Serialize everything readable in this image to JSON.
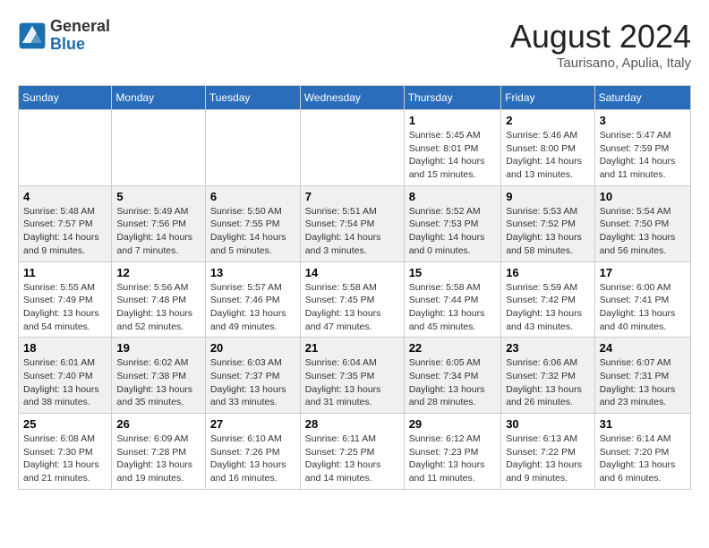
{
  "header": {
    "logo": {
      "general": "General",
      "blue": "Blue"
    },
    "title": "August 2024",
    "location": "Taurisano, Apulia, Italy"
  },
  "days_of_week": [
    "Sunday",
    "Monday",
    "Tuesday",
    "Wednesday",
    "Thursday",
    "Friday",
    "Saturday"
  ],
  "weeks": [
    [
      {
        "day": "",
        "info": ""
      },
      {
        "day": "",
        "info": ""
      },
      {
        "day": "",
        "info": ""
      },
      {
        "day": "",
        "info": ""
      },
      {
        "day": "1",
        "info": "Sunrise: 5:45 AM\nSunset: 8:01 PM\nDaylight: 14 hours and 15 minutes."
      },
      {
        "day": "2",
        "info": "Sunrise: 5:46 AM\nSunset: 8:00 PM\nDaylight: 14 hours and 13 minutes."
      },
      {
        "day": "3",
        "info": "Sunrise: 5:47 AM\nSunset: 7:59 PM\nDaylight: 14 hours and 11 minutes."
      }
    ],
    [
      {
        "day": "4",
        "info": "Sunrise: 5:48 AM\nSunset: 7:57 PM\nDaylight: 14 hours and 9 minutes."
      },
      {
        "day": "5",
        "info": "Sunrise: 5:49 AM\nSunset: 7:56 PM\nDaylight: 14 hours and 7 minutes."
      },
      {
        "day": "6",
        "info": "Sunrise: 5:50 AM\nSunset: 7:55 PM\nDaylight: 14 hours and 5 minutes."
      },
      {
        "day": "7",
        "info": "Sunrise: 5:51 AM\nSunset: 7:54 PM\nDaylight: 14 hours and 3 minutes."
      },
      {
        "day": "8",
        "info": "Sunrise: 5:52 AM\nSunset: 7:53 PM\nDaylight: 14 hours and 0 minutes."
      },
      {
        "day": "9",
        "info": "Sunrise: 5:53 AM\nSunset: 7:52 PM\nDaylight: 13 hours and 58 minutes."
      },
      {
        "day": "10",
        "info": "Sunrise: 5:54 AM\nSunset: 7:50 PM\nDaylight: 13 hours and 56 minutes."
      }
    ],
    [
      {
        "day": "11",
        "info": "Sunrise: 5:55 AM\nSunset: 7:49 PM\nDaylight: 13 hours and 54 minutes."
      },
      {
        "day": "12",
        "info": "Sunrise: 5:56 AM\nSunset: 7:48 PM\nDaylight: 13 hours and 52 minutes."
      },
      {
        "day": "13",
        "info": "Sunrise: 5:57 AM\nSunset: 7:46 PM\nDaylight: 13 hours and 49 minutes."
      },
      {
        "day": "14",
        "info": "Sunrise: 5:58 AM\nSunset: 7:45 PM\nDaylight: 13 hours and 47 minutes."
      },
      {
        "day": "15",
        "info": "Sunrise: 5:58 AM\nSunset: 7:44 PM\nDaylight: 13 hours and 45 minutes."
      },
      {
        "day": "16",
        "info": "Sunrise: 5:59 AM\nSunset: 7:42 PM\nDaylight: 13 hours and 43 minutes."
      },
      {
        "day": "17",
        "info": "Sunrise: 6:00 AM\nSunset: 7:41 PM\nDaylight: 13 hours and 40 minutes."
      }
    ],
    [
      {
        "day": "18",
        "info": "Sunrise: 6:01 AM\nSunset: 7:40 PM\nDaylight: 13 hours and 38 minutes."
      },
      {
        "day": "19",
        "info": "Sunrise: 6:02 AM\nSunset: 7:38 PM\nDaylight: 13 hours and 35 minutes."
      },
      {
        "day": "20",
        "info": "Sunrise: 6:03 AM\nSunset: 7:37 PM\nDaylight: 13 hours and 33 minutes."
      },
      {
        "day": "21",
        "info": "Sunrise: 6:04 AM\nSunset: 7:35 PM\nDaylight: 13 hours and 31 minutes."
      },
      {
        "day": "22",
        "info": "Sunrise: 6:05 AM\nSunset: 7:34 PM\nDaylight: 13 hours and 28 minutes."
      },
      {
        "day": "23",
        "info": "Sunrise: 6:06 AM\nSunset: 7:32 PM\nDaylight: 13 hours and 26 minutes."
      },
      {
        "day": "24",
        "info": "Sunrise: 6:07 AM\nSunset: 7:31 PM\nDaylight: 13 hours and 23 minutes."
      }
    ],
    [
      {
        "day": "25",
        "info": "Sunrise: 6:08 AM\nSunset: 7:30 PM\nDaylight: 13 hours and 21 minutes."
      },
      {
        "day": "26",
        "info": "Sunrise: 6:09 AM\nSunset: 7:28 PM\nDaylight: 13 hours and 19 minutes."
      },
      {
        "day": "27",
        "info": "Sunrise: 6:10 AM\nSunset: 7:26 PM\nDaylight: 13 hours and 16 minutes."
      },
      {
        "day": "28",
        "info": "Sunrise: 6:11 AM\nSunset: 7:25 PM\nDaylight: 13 hours and 14 minutes."
      },
      {
        "day": "29",
        "info": "Sunrise: 6:12 AM\nSunset: 7:23 PM\nDaylight: 13 hours and 11 minutes."
      },
      {
        "day": "30",
        "info": "Sunrise: 6:13 AM\nSunset: 7:22 PM\nDaylight: 13 hours and 9 minutes."
      },
      {
        "day": "31",
        "info": "Sunrise: 6:14 AM\nSunset: 7:20 PM\nDaylight: 13 hours and 6 minutes."
      }
    ]
  ]
}
